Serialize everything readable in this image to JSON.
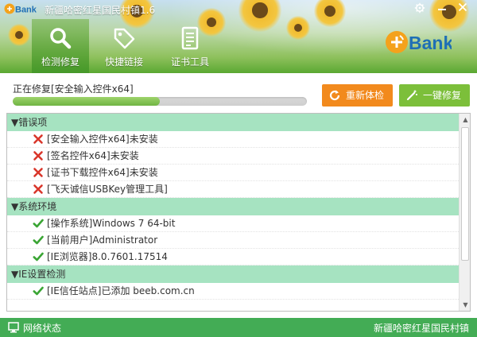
{
  "app": {
    "logo_text": "eBank",
    "title": "新疆哈密红星国民村镇1.6"
  },
  "window_controls": {
    "settings_icon": "gear-icon",
    "minimize_icon": "minimize-icon",
    "close_icon": "close-icon"
  },
  "nav": {
    "tabs": [
      {
        "label": "检测修复",
        "icon": "search-icon",
        "active": true
      },
      {
        "label": "快捷链接",
        "icon": "tag-icon",
        "active": false
      },
      {
        "label": "证书工具",
        "icon": "document-icon",
        "active": false
      }
    ]
  },
  "brand": {
    "logo_text": "eBank"
  },
  "progress": {
    "status": "正在修复[安全输入控件x64]",
    "percent": 50
  },
  "actions": {
    "recheck_label": "重新体检",
    "repair_label": "一键修复"
  },
  "sections": [
    {
      "title": "▼错误项",
      "items": [
        {
          "status": "error",
          "text": "[安全输入控件x64]未安装"
        },
        {
          "status": "error",
          "text": "[签名控件x64]未安装"
        },
        {
          "status": "error",
          "text": "[证书下载控件x64]未安装"
        },
        {
          "status": "error",
          "text": "[飞天诚信USBKey管理工具]"
        }
      ]
    },
    {
      "title": "▼系统环境",
      "items": [
        {
          "status": "ok",
          "text": "[操作系统]Windows 7 64-bit"
        },
        {
          "status": "ok",
          "text": "[当前用户]Administrator"
        },
        {
          "status": "ok",
          "text": "[IE浏览器]8.0.7601.17514"
        }
      ]
    },
    {
      "title": "▼IE设置检测",
      "items": [
        {
          "status": "ok",
          "text": "[IE信任站点]已添加 beeb.com.cn"
        }
      ]
    }
  ],
  "footer": {
    "network_label": "网络状态",
    "right_text": "新疆哈密红星国民村镇"
  },
  "colors": {
    "accent_green": "#43ac55",
    "section_bg": "#a6e3c1",
    "orange_button": "#f28a1d",
    "green_button": "#7cbf3a",
    "error_red": "#d9362b",
    "ok_green": "#3aa534"
  }
}
